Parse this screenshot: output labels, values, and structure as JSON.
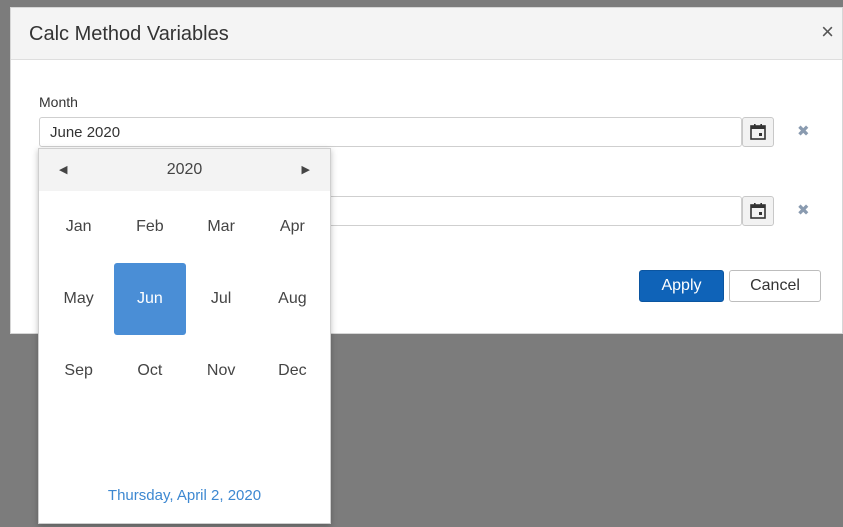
{
  "dialog": {
    "title": "Calc Method Variables",
    "close_glyph": "×"
  },
  "fields": [
    {
      "label": "Month",
      "value": "June 2020"
    },
    {
      "label": "",
      "value": ""
    }
  ],
  "clear_glyph": "✖",
  "buttons": {
    "apply": "Apply",
    "cancel": "Cancel"
  },
  "picker": {
    "prev_glyph": "◀",
    "next_glyph": "▶",
    "year": "2020",
    "months": [
      "Jan",
      "Feb",
      "Mar",
      "Apr",
      "May",
      "Jun",
      "Jul",
      "Aug",
      "Sep",
      "Oct",
      "Nov",
      "Dec"
    ],
    "selected_month": "Jun",
    "today": "Thursday, April 2, 2020"
  },
  "colors": {
    "accent": "#0f63b8",
    "selected": "#4a8ed6",
    "link": "#3d88d1",
    "overlay": "#7c7c7c"
  }
}
